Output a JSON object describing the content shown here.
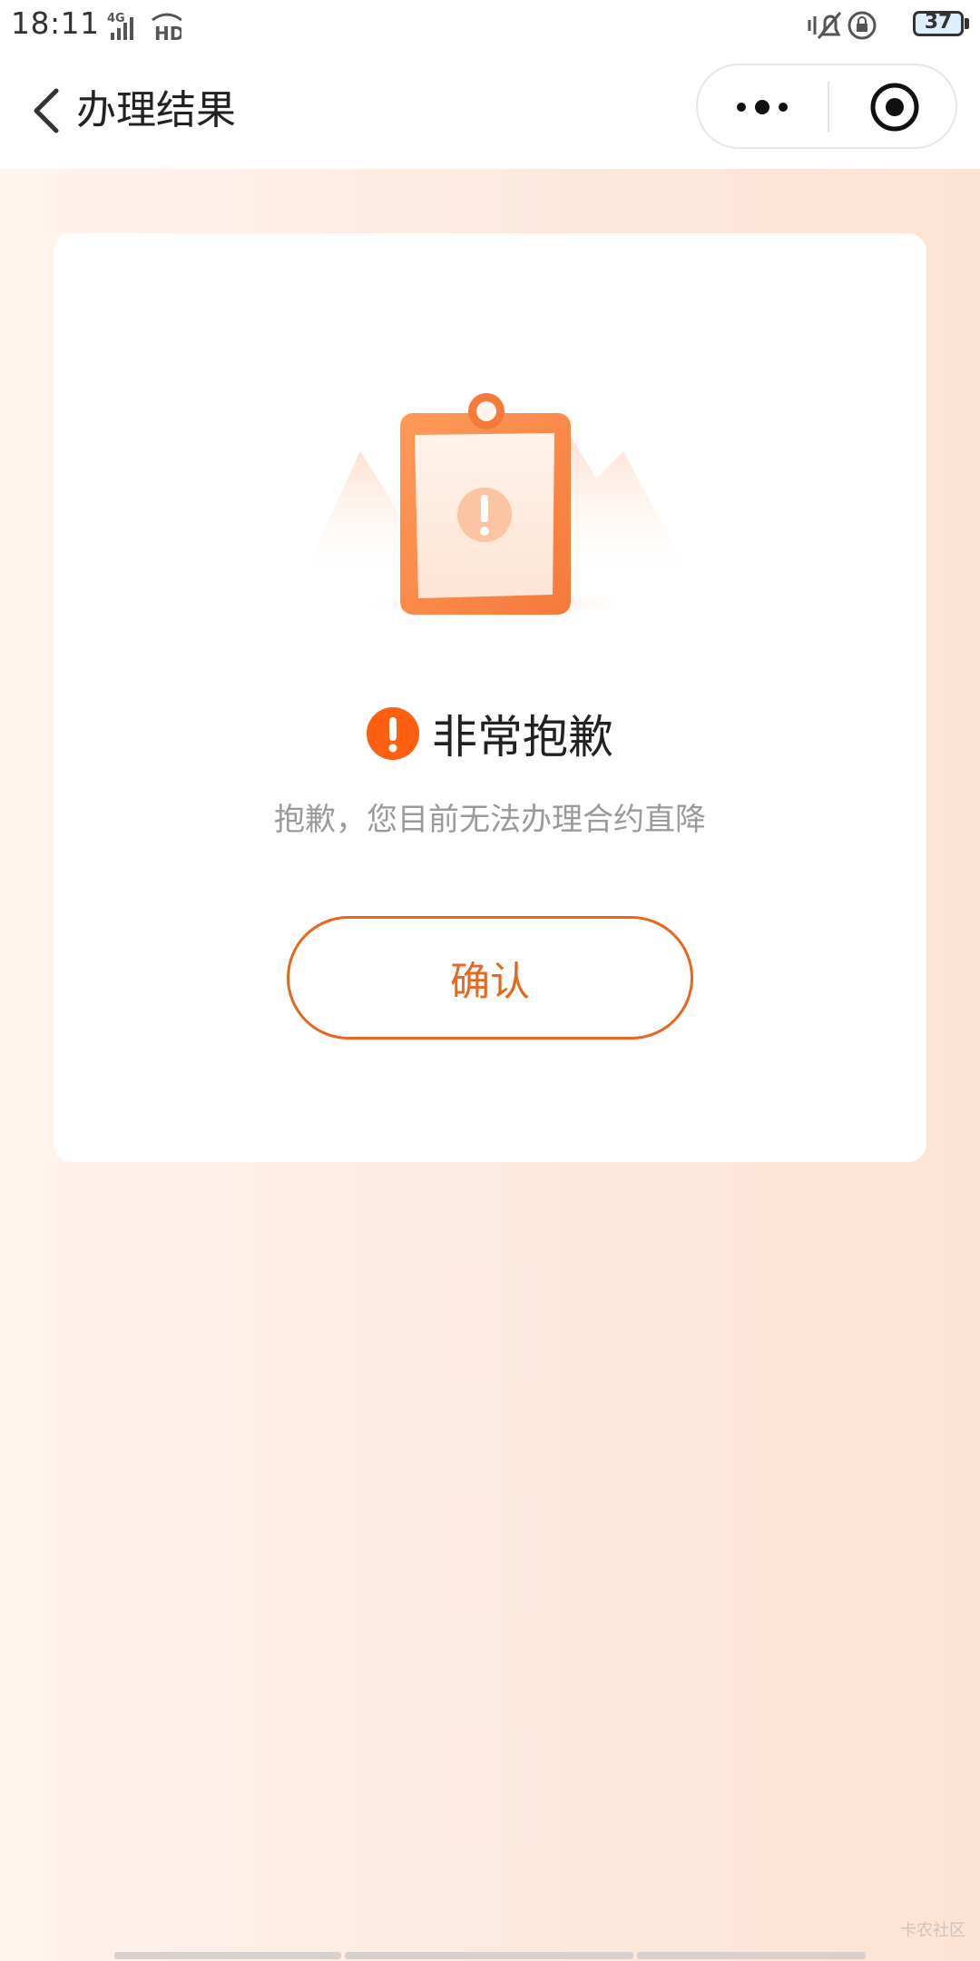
{
  "status_bar": {
    "time": "18:11",
    "network": "4G",
    "hd": "HD",
    "battery": "37"
  },
  "nav": {
    "title": "办理结果"
  },
  "result": {
    "heading": "非常抱歉",
    "message": "抱歉，您目前无法办理合约直降",
    "confirm_label": "确认"
  },
  "watermark": "卡农社区",
  "colors": {
    "accent": "#e8661e",
    "warning": "#ff5f10",
    "background": "#fde8dd"
  }
}
